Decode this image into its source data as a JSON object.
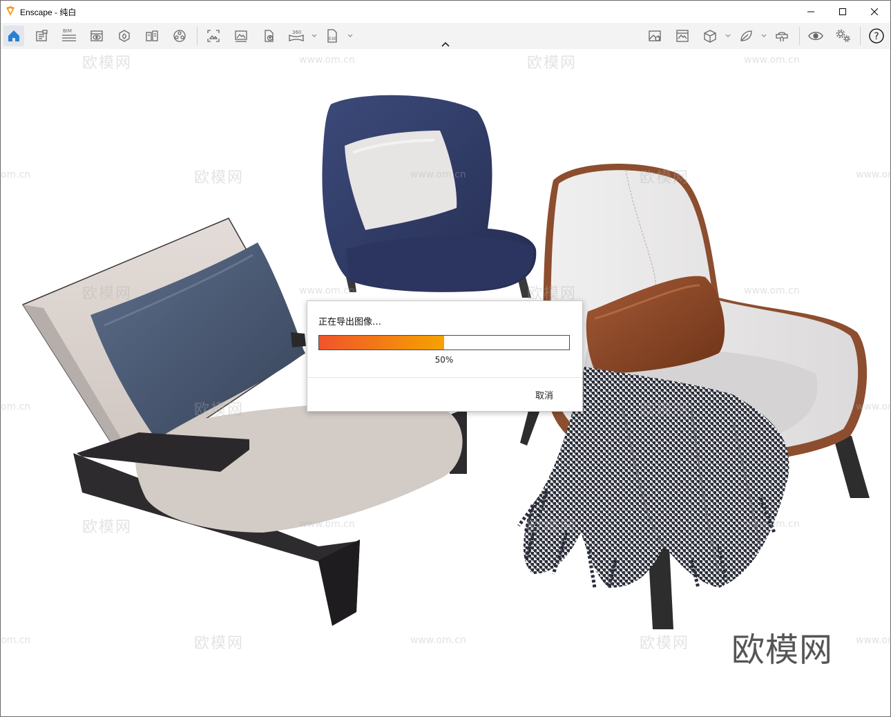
{
  "window": {
    "title": "Enscape - 纯白",
    "app_icon": "enscape-logo-icon",
    "controls": [
      "minimize-icon",
      "maximize-icon",
      "close-icon"
    ]
  },
  "toolbar": {
    "left_tools": [
      {
        "icon": "home-icon",
        "active": true
      },
      {
        "icon": "document-icon"
      },
      {
        "icon": "bim-icon",
        "label": "BIM"
      },
      {
        "icon": "view-icon"
      },
      {
        "icon": "asset-library-icon"
      },
      {
        "icon": "material-icon"
      },
      {
        "icon": "video-editor-icon"
      },
      {
        "icon": "screenshot-icon"
      },
      {
        "icon": "batch-render-icon"
      },
      {
        "icon": "upload-icon"
      },
      {
        "icon": "panorama-360-icon",
        "label": "360"
      },
      {
        "icon": "exe-export-icon",
        "label": "EXE"
      }
    ],
    "right_tools": [
      {
        "icon": "visual-settings-icon"
      },
      {
        "icon": "render-preview-icon"
      },
      {
        "icon": "views-cube-icon"
      },
      {
        "icon": "atmosphere-icon"
      },
      {
        "icon": "vr-headset-icon"
      },
      {
        "icon": "eye-icon"
      },
      {
        "icon": "settings-icon"
      },
      {
        "icon": "help-icon",
        "label": "?"
      }
    ]
  },
  "viewport": {
    "watermark_text": "欧模网",
    "watermark_url": "www.om.cn",
    "watermark_url_partial": "om.cn",
    "brand_text": "欧模网"
  },
  "dialog": {
    "title": "正在导出图像…",
    "progress": 0.5,
    "progress_text": "50%",
    "cancel_label": "取消",
    "colors": {
      "fill_start": "#f0542a",
      "fill_end": "#f5a300"
    }
  }
}
